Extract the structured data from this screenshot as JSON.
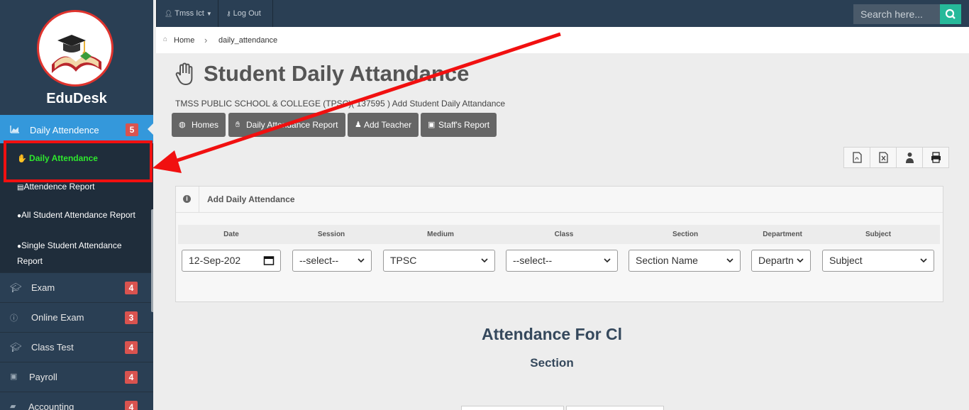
{
  "app": {
    "brand": "EduDesk"
  },
  "sidebar": {
    "active_menu": {
      "label": "Daily Attendence",
      "badge": "5"
    },
    "submenu": [
      {
        "label": "Daily Attendance"
      },
      {
        "label": "Attendence Report"
      },
      {
        "label": "All Student Attendance Report"
      },
      {
        "label": "Single Student Attendance",
        "label2": "Report"
      }
    ],
    "items": [
      {
        "label": "Exam",
        "badge": "4"
      },
      {
        "label": "Online Exam",
        "badge": "3"
      },
      {
        "label": "Class Test",
        "badge": "4"
      },
      {
        "label": "Payroll",
        "badge": "4"
      },
      {
        "label": "Accounting",
        "badge": "4"
      }
    ]
  },
  "topbar": {
    "user": "Tmss Ict",
    "logout": "Log Out",
    "search_placeholder": "Search here..."
  },
  "breadcrumb": {
    "home": "Home",
    "current": "daily_attendance"
  },
  "page": {
    "title": "Student Daily Attandance",
    "subtitle": "TMSS PUBLIC SCHOOL & COLLEGE (TPSC)( 137595 ) Add Student Daily Attandance"
  },
  "nav_buttons": {
    "homes": "Homes",
    "daily_report": "Daily Attendance Report",
    "add_teacher": "Add Teacher",
    "staff_report": "Staff's Report"
  },
  "panel": {
    "title": "Add Daily Attendance",
    "columns": [
      "Date",
      "Session",
      "Medium",
      "Class",
      "Section",
      "Department",
      "Subject"
    ],
    "fields": {
      "date": "12-Sep-202",
      "session": "--select--",
      "medium": "TPSC",
      "class": "--select--",
      "section": "Section Name",
      "department": "Departn",
      "subject": "Subject"
    }
  },
  "attendance": {
    "title": "Attendance For Cl",
    "section": "Section"
  },
  "annotation": {
    "color": "#f11010"
  }
}
